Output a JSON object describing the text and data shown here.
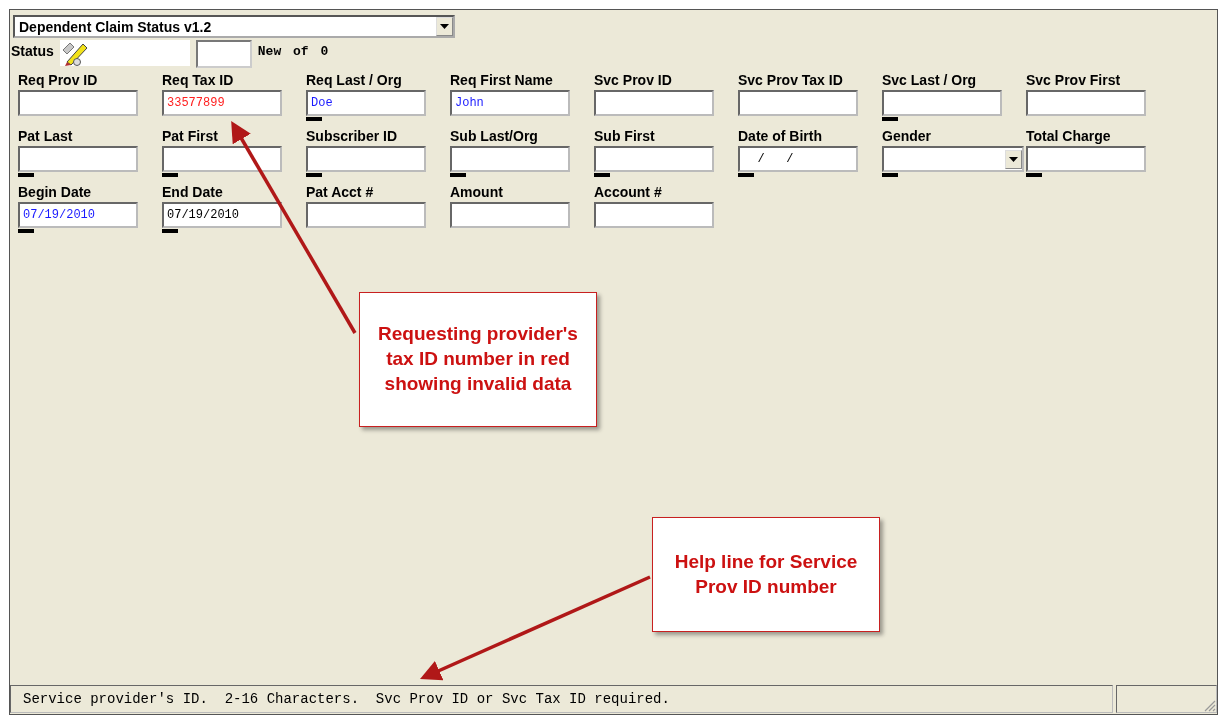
{
  "form": {
    "title": "Dependent Claim Status v1.2",
    "status_label": "Status",
    "counter": "New of 0"
  },
  "fields": [
    {
      "label": "Req Prov ID",
      "kind": "text",
      "marker": false
    },
    {
      "label": "Req Tax ID",
      "value": "33577899",
      "kind": "text",
      "invalid": true,
      "validated": false,
      "marker": false
    },
    {
      "label": "Req Last / Org",
      "value": "Doe",
      "kind": "text",
      "invalid": false,
      "validated": true,
      "marker": true
    },
    {
      "label": "Req First Name",
      "value": "John",
      "kind": "text",
      "invalid": false,
      "validated": true,
      "marker": false
    },
    {
      "label": "Svc Prov ID",
      "kind": "text",
      "marker": false
    },
    {
      "label": "Svc Prov Tax ID",
      "kind": "text",
      "marker": false
    },
    {
      "label": "Svc Last / Org",
      "kind": "text",
      "marker": true
    },
    {
      "label": "Svc Prov First",
      "kind": "text",
      "marker": false
    },
    {
      "label": "Pat Last",
      "kind": "text",
      "marker": true
    },
    {
      "label": "Pat First",
      "kind": "text",
      "marker": true
    },
    {
      "label": "Subscriber ID",
      "kind": "text",
      "marker": true
    },
    {
      "label": "Sub Last/Org",
      "kind": "text",
      "marker": true
    },
    {
      "label": "Sub First",
      "kind": "text",
      "marker": true
    },
    {
      "label": "Date of Birth",
      "value": "  /   /",
      "kind": "text",
      "invalid": false,
      "validated": false,
      "marker": true
    },
    {
      "label": "Gender",
      "kind": "dropdown",
      "marker": true
    },
    {
      "label": "Total Charge",
      "kind": "text",
      "marker": true
    },
    {
      "label": "Begin Date",
      "value": "07/19/2010",
      "kind": "text",
      "invalid": false,
      "validated": true,
      "marker": true
    },
    {
      "label": "End Date",
      "value": "07/19/2010",
      "kind": "text",
      "invalid": false,
      "validated": false,
      "marker": true
    },
    {
      "label": "Pat Acct #",
      "kind": "text",
      "marker": false
    },
    {
      "label": "Amount",
      "kind": "text",
      "marker": false
    },
    {
      "label": "Account #",
      "kind": "text",
      "marker": false
    }
  ],
  "callouts": [
    {
      "text": "Requesting provider's tax ID number in red showing invalid data"
    },
    {
      "text": "Help line for Service Prov ID number"
    }
  ],
  "status_bar": {
    "message": "Service provider's ID.  2-16 Characters.  Svc Prov ID or Svc Tax ID required."
  }
}
